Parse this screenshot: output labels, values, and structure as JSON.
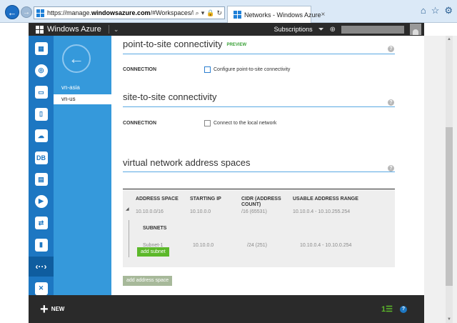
{
  "browser": {
    "url_prefix": "https://manage.",
    "url_domain": "windowsazure.com",
    "url_rest": "/#Workspaces/NetworkExtension/Vi",
    "tab_title": "Networks - Windows Azure",
    "tab_close": "×",
    "back_glyph": "←",
    "forward_glyph": "→",
    "icons": [
      "search-icon",
      "lock-icon",
      "refresh-icon",
      "home-icon",
      "star-icon",
      "gear-icon"
    ]
  },
  "header": {
    "title": "Windows Azure",
    "chevron": "⌄",
    "subscriptions_label": "Subscriptions"
  },
  "sidebar": {
    "items": [
      {
        "name": "all-items",
        "glyph": "▦"
      },
      {
        "name": "web-sites",
        "glyph": "◎"
      },
      {
        "name": "virtual-machines",
        "glyph": "▭"
      },
      {
        "name": "mobile-services",
        "glyph": "▯"
      },
      {
        "name": "cloud-services",
        "glyph": "☁"
      },
      {
        "name": "sql-databases",
        "glyph": "DB"
      },
      {
        "name": "storage",
        "glyph": "▤"
      },
      {
        "name": "media-services",
        "glyph": "▶"
      },
      {
        "name": "service-bus",
        "glyph": "⇄"
      },
      {
        "name": "active-directory",
        "glyph": "▮"
      },
      {
        "name": "networks",
        "glyph": "‹··›"
      },
      {
        "name": "traffic-manager",
        "glyph": "✕"
      }
    ],
    "back_glyph": "←",
    "networks": [
      "vn-asia",
      "vn-us"
    ],
    "selected_network": "vn-us"
  },
  "p2s": {
    "title": "point-to-site connectivity",
    "preview": "PREVIEW",
    "field_label": "CONNECTION",
    "checkbox_label": "Configure point-to-site connectivity"
  },
  "s2s": {
    "title": "site-to-site connectivity",
    "field_label": "CONNECTION",
    "checkbox_label": "Connect to the local network"
  },
  "address_spaces": {
    "title": "virtual network address spaces",
    "columns": [
      "ADDRESS SPACE",
      "STARTING IP",
      "CIDR (ADDRESS COUNT)",
      "USABLE ADDRESS RANGE"
    ],
    "row": {
      "address_space": "10.10.0.0/16",
      "starting_ip": "10.10.0.0",
      "cidr": "/16 (65531)",
      "usable_range": "10.10.0.4 - 10.10.255.254"
    },
    "subnets_heading": "SUBNETS",
    "subnet": {
      "name": "Subnet-1",
      "starting_ip": "10.10.0.0",
      "cidr": "/24 (251)",
      "usable_range": "10.10.0.4 - 10.10.0.254"
    },
    "add_subnet_label": "add subnet",
    "add_address_space_label": "add address space"
  },
  "help_glyph": "?",
  "bottom_bar": {
    "new_label": "NEW",
    "plus_glyph": "+",
    "activity_count": "1",
    "help_glyph": "?"
  },
  "colors": {
    "accent": "#1d77c2",
    "subpanel": "#3599db",
    "green": "#5cb82a",
    "dark": "#2a2a2a"
  }
}
